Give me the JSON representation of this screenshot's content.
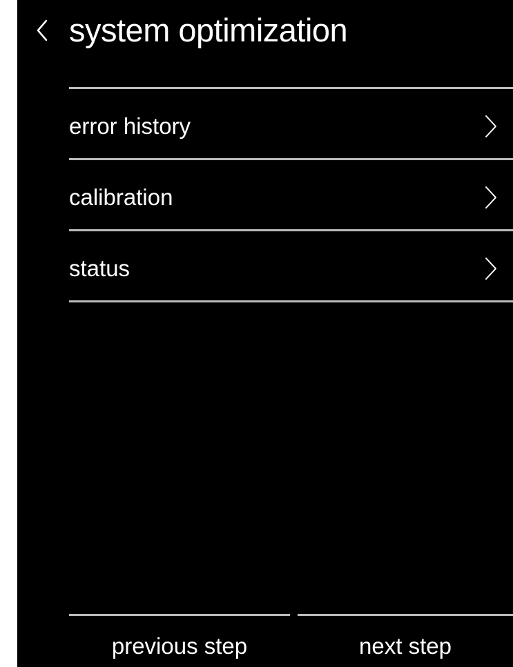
{
  "header": {
    "back_icon": "chevron-left-icon",
    "title": "system optimization"
  },
  "menu": {
    "items": [
      {
        "label": "error history",
        "icon": "chevron-right-icon"
      },
      {
        "label": "calibration",
        "icon": "chevron-right-icon"
      },
      {
        "label": "status",
        "icon": "chevron-right-icon"
      }
    ]
  },
  "footer": {
    "previous_label": "previous step",
    "next_label": "next step"
  },
  "colors": {
    "background": "#000000",
    "text": "#ffffff",
    "divider": "#bdbdbd"
  }
}
